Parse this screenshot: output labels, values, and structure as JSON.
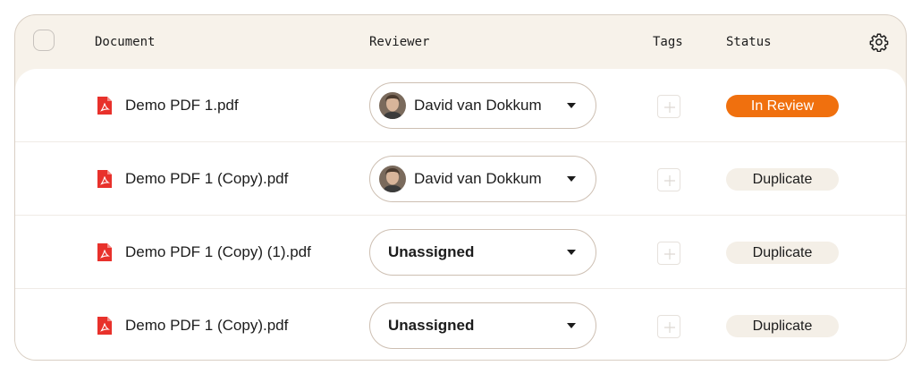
{
  "header": {
    "document": "Document",
    "reviewer": "Reviewer",
    "tags": "Tags",
    "status": "Status"
  },
  "rows": [
    {
      "document": "Demo PDF 1.pdf",
      "reviewer": "David van Dokkum",
      "status": "In Review"
    },
    {
      "document": "Demo PDF 1 (Copy).pdf",
      "reviewer": "David van Dokkum",
      "status": "Duplicate"
    },
    {
      "document": "Demo PDF 1 (Copy) (1).pdf",
      "reviewer": "Unassigned",
      "status": "Duplicate"
    },
    {
      "document": "Demo PDF 1 (Copy).pdf",
      "reviewer": "Unassigned",
      "status": "Duplicate"
    }
  ],
  "colors": {
    "in_review": "#f0700e",
    "duplicate_bg": "#f4efe7",
    "pdf_red": "#e8312b",
    "header_bg": "#f7f2ea"
  },
  "icons": {
    "file": "pdf-file-icon",
    "settings": "gear-icon",
    "add_tag": "plus-icon",
    "dropdown": "caret-down-icon"
  }
}
